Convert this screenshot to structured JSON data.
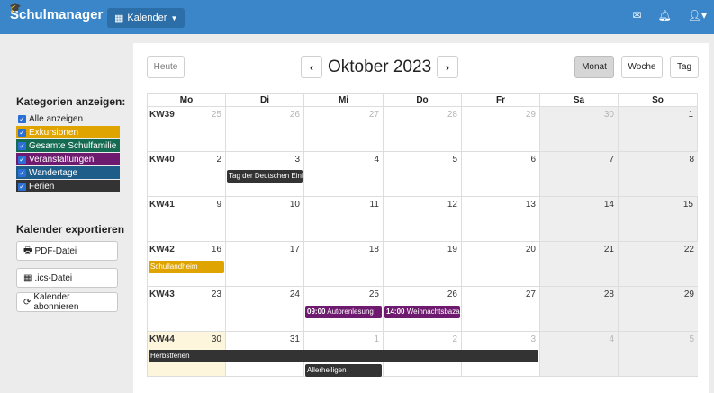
{
  "navbar": {
    "brand": "Schulmanager",
    "calendar_menu": "Kalender",
    "icons": [
      "mail-icon",
      "bell-icon",
      "user-icon"
    ]
  },
  "sidebar": {
    "categories_heading": "Kategorien anzeigen:",
    "categories": [
      {
        "label": "Alle anzeigen",
        "color": ""
      },
      {
        "label": "Exkursionen",
        "color": "#e0a400"
      },
      {
        "label": "Gesamte Schulfamilie",
        "color": "#146b52"
      },
      {
        "label": "Veranstaltungen",
        "color": "#6e1a6e"
      },
      {
        "label": "Wandertage",
        "color": "#1e5d8a"
      },
      {
        "label": "Ferien",
        "color": "#333333"
      }
    ],
    "export_heading": "Kalender exportieren",
    "export_buttons": [
      "PDF-Datei",
      ".ics-Datei",
      "Kalender abonnieren"
    ]
  },
  "calendar": {
    "today_label": "Heute",
    "title": "Oktober 2023",
    "views": [
      "Monat",
      "Woche",
      "Tag"
    ],
    "active_view": "Monat",
    "weekdays": [
      "Mo",
      "Di",
      "Mi",
      "Do",
      "Fr",
      "Sa",
      "So"
    ],
    "weeks": [
      {
        "kw": "KW39",
        "days": [
          "25",
          "26",
          "27",
          "28",
          "29",
          "30",
          "1"
        ]
      },
      {
        "kw": "KW40",
        "days": [
          "2",
          "3",
          "4",
          "5",
          "6",
          "7",
          "8"
        ]
      },
      {
        "kw": "KW41",
        "days": [
          "9",
          "10",
          "11",
          "12",
          "13",
          "14",
          "15"
        ]
      },
      {
        "kw": "KW42",
        "days": [
          "16",
          "17",
          "18",
          "19",
          "20",
          "21",
          "22"
        ]
      },
      {
        "kw": "KW43",
        "days": [
          "23",
          "24",
          "25",
          "26",
          "27",
          "28",
          "29"
        ]
      },
      {
        "kw": "KW44",
        "days": [
          "30",
          "31",
          "1",
          "2",
          "3",
          "4",
          "5"
        ]
      }
    ],
    "events": [
      {
        "title": "Tag der Deutschen Einh",
        "time": "",
        "color": "#333333"
      },
      {
        "title": "Schullandheim",
        "time": "",
        "color": "#e0a400"
      },
      {
        "title": "Autorenlesung",
        "time": "09:00",
        "color": "#6e1a6e"
      },
      {
        "title": "Weihnachtsbaza",
        "time": "14:00",
        "color": "#6e1a6e"
      },
      {
        "title": "Herbstferien",
        "time": "",
        "color": "#333333"
      },
      {
        "title": "Allerheiligen",
        "time": "",
        "color": "#333333"
      }
    ]
  }
}
